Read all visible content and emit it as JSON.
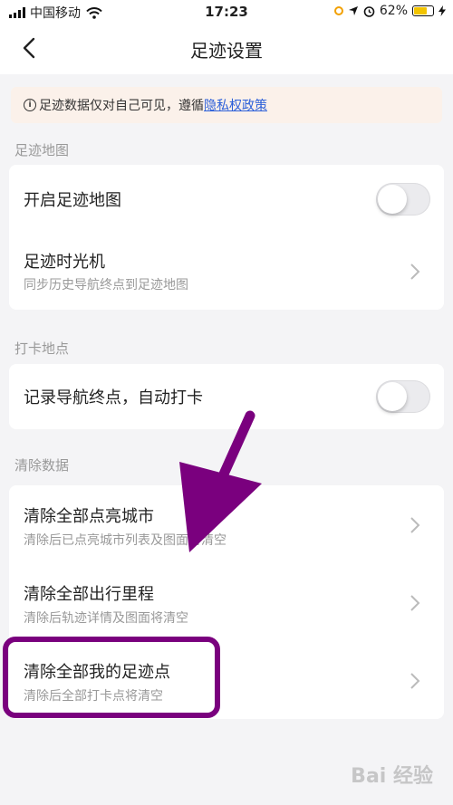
{
  "status_bar": {
    "carrier": "中国移动",
    "time": "17:23",
    "battery": "62%",
    "battery_level": 0.62
  },
  "nav": {
    "title": "足迹设置"
  },
  "notice": {
    "text": "足迹数据仅对自己可见，遵循",
    "link": "隐私权政策"
  },
  "sections": [
    {
      "title": "足迹地图",
      "rows": [
        {
          "title": "开启足迹地图",
          "control": "toggle",
          "on": false
        },
        {
          "title": "足迹时光机",
          "subtitle": "同步历史导航终点到足迹地图",
          "control": "chevron"
        }
      ]
    },
    {
      "title": "打卡地点",
      "rows": [
        {
          "title": "记录导航终点，自动打卡",
          "control": "toggle",
          "on": false
        }
      ]
    },
    {
      "title": "清除数据",
      "rows": [
        {
          "title": "清除全部点亮城市",
          "subtitle": "清除后已点亮城市列表及图面将清空",
          "control": "chevron"
        },
        {
          "title": "清除全部出行里程",
          "subtitle": "清除后轨迹详情及图面将清空",
          "control": "chevron"
        },
        {
          "title": "清除全部我的足迹点",
          "subtitle": "清除后全部打卡点将清空",
          "control": "chevron"
        }
      ]
    }
  ],
  "annotation": {
    "color": "#7a007e"
  },
  "watermark": "Bai 经验"
}
